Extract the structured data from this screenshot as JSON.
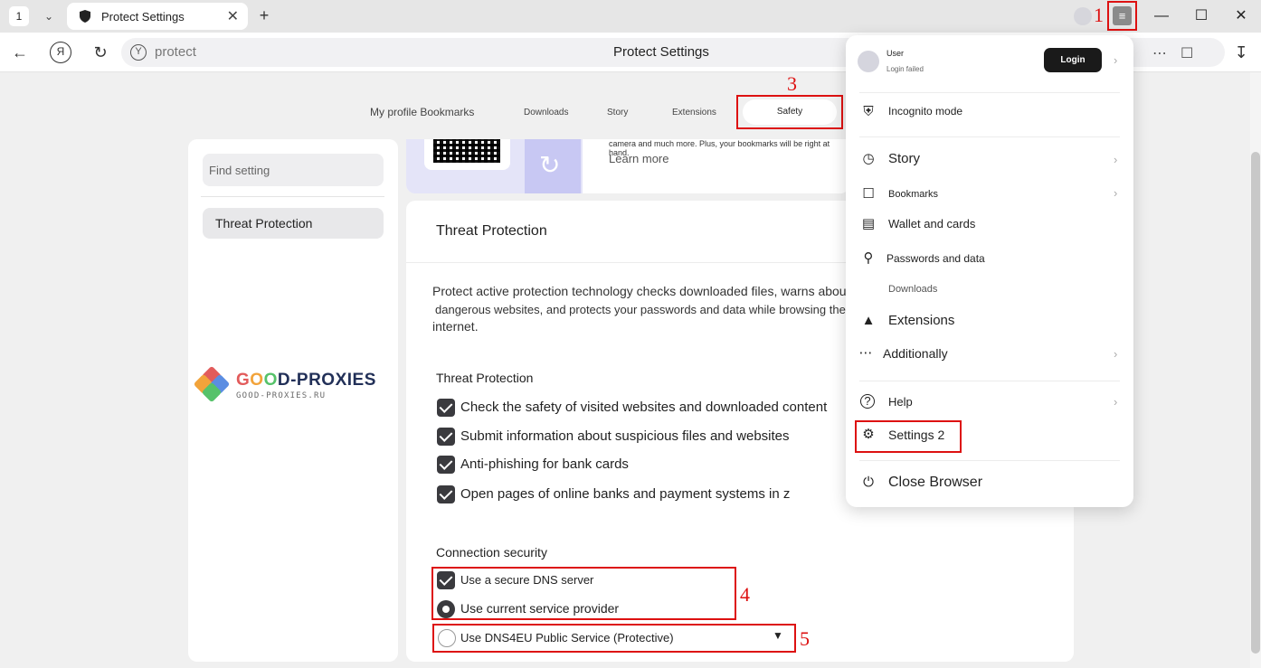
{
  "browser": {
    "tab_count": "1",
    "tab_title": "Protect Settings",
    "address_text": "protect",
    "page_title": "Protect Settings"
  },
  "annotations": {
    "n1": "1",
    "n3": "3",
    "n4": "4",
    "n5": "5",
    "color": "#dd1111"
  },
  "top_nav": {
    "items": [
      "My profile Bookmarks",
      "Downloads",
      "Story",
      "Extensions"
    ],
    "active": "Safety"
  },
  "sidebar": {
    "search_placeholder": "Find setting",
    "active_item": "Threat Protection"
  },
  "promo": {
    "text": "camera and much more. Plus, your bookmarks will be right at hand.",
    "link": "Learn more"
  },
  "watermark": {
    "brand_a": "G",
    "brand_b": "D-PROXIES",
    "domain": "GOOD-PROXIES.RU"
  },
  "main": {
    "title": "Threat Protection",
    "description_1": "Protect active protection technology checks downloaded files, warns about",
    "description_2": "dangerous websites, and protects your passwords and data while browsing the",
    "description_3": "internet.",
    "threat_heading": "Threat Protection",
    "checks": [
      "Check the safety of visited websites and downloaded content",
      "Submit information about suspicious files and websites",
      "Anti-phishing for bank cards",
      "Open pages of online banks and payment systems in z"
    ],
    "connection_heading": "Connection security",
    "secure_dns": "Use a secure DNS server",
    "current_provider": "Use current service provider",
    "dns_option": "Use DNS4EU Public Service (Protective)"
  },
  "menu": {
    "user": "User",
    "login_status": "Login failed",
    "login_button": "Login",
    "incognito": "Incognito mode",
    "story": "Story",
    "bookmarks": "Bookmarks",
    "wallet": "Wallet and cards",
    "passwords": "Passwords and data",
    "downloads": "Downloads",
    "extensions": "Extensions",
    "additionally": "Additionally",
    "help": "Help",
    "settings": "Settings 2",
    "close": "Close Browser"
  }
}
